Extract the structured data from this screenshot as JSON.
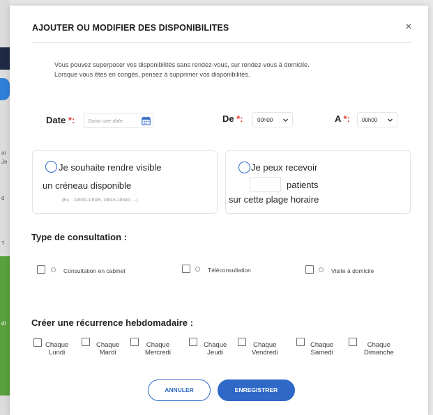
{
  "background": {
    "fragments": [
      "ai",
      "Je",
      "d",
      "?",
      "di"
    ]
  },
  "modal": {
    "title": "AJOUTER OU MODIFIER DES DISPONIBILITES",
    "close_icon": "close-icon",
    "close_glyph": "×"
  },
  "intro": {
    "line1": "Vous pouvez superposer vos disponibilités sans rendez-vous, sur rendez-vous à domicile.",
    "line2": "Lorsque vous êtes en congés, pensez à supprimer vos disponibilités."
  },
  "fields": {
    "date_label": "Date",
    "date_placeholder": "Saisir une date",
    "from_label": "De",
    "from_value": "00h00",
    "to_label": "A",
    "to_value": "00h00",
    "required_mark": "*:"
  },
  "visible_slot": {
    "line1": "Je souhaite rendre visible",
    "line2": "un créneau disponible",
    "hint": "(Ex. : 10h00-10h15, 10h15-10h30, ...)"
  },
  "capacity": {
    "line1": "Je peux recevoir",
    "patients_label": "patients",
    "line3": "sur cette plage horaire",
    "patients_value": ""
  },
  "consultation": {
    "title": "Type de consultation :",
    "options": [
      "Consultation en cabinet",
      "Téléconsultation",
      "Visite à domicile"
    ]
  },
  "recurrence": {
    "title": "Créer une récurrence hebdomadaire :",
    "prefix": "Chaque",
    "days": [
      "Lundi",
      "Mardi",
      "Mercredi",
      "Jeudi",
      "Vendredi",
      "Samedi",
      "Dimanche"
    ]
  },
  "actions": {
    "cancel": "ANNULER",
    "save": "ENREGISTRER"
  },
  "colors": {
    "accent": "#2f68c7",
    "required": "#e53935",
    "navy": "#1f2a44",
    "green": "#59a13c"
  }
}
